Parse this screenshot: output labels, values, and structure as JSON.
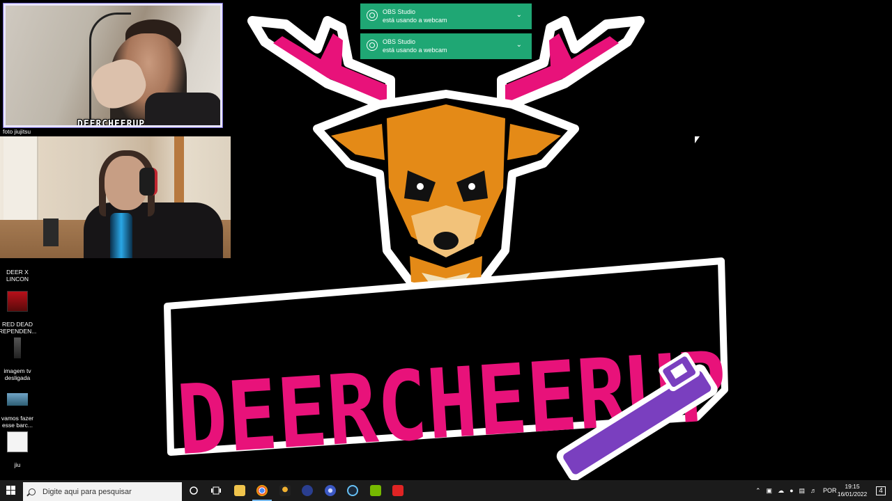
{
  "overlays": {
    "cam_top_watermark": "DEERCHEERUP",
    "cam_top_caption": "foto jiujitsu"
  },
  "desktop_icons": [
    {
      "label": "DEER X\nLINCON",
      "icon": "folder-label"
    },
    {
      "label": "RED DEAD\nREPENDEN...",
      "icon": "game-thumbnail"
    },
    {
      "label": "imagem tv\ndesligada",
      "icon": "image-thumbnail"
    },
    {
      "label": "vamos fazer\nesse barc...",
      "icon": "image-thumbnail"
    },
    {
      "label": "jiu",
      "icon": "image-thumbnail"
    }
  ],
  "notifications": [
    {
      "app": "OBS Studio",
      "message": "está usando a webcam"
    },
    {
      "app": "OBS Studio",
      "message": "está usando a webcam"
    }
  ],
  "logo": {
    "text": "DEERCHEERUP",
    "colors": {
      "pink": "#e8127a",
      "orange": "#e48a17",
      "purple": "#7a3fbf",
      "outline": "#ffffff"
    }
  },
  "taskbar": {
    "search_placeholder": "Digite aqui para pesquisar",
    "apps": [
      "cortana",
      "task-view",
      "file-explorer",
      "chrome",
      "game-launcher",
      "ice-app",
      "obs",
      "steam",
      "nvidia",
      "red-app"
    ],
    "tray": {
      "language": "POR",
      "time": "19:15",
      "date": "16/01/2022",
      "notification_count": "4"
    }
  }
}
